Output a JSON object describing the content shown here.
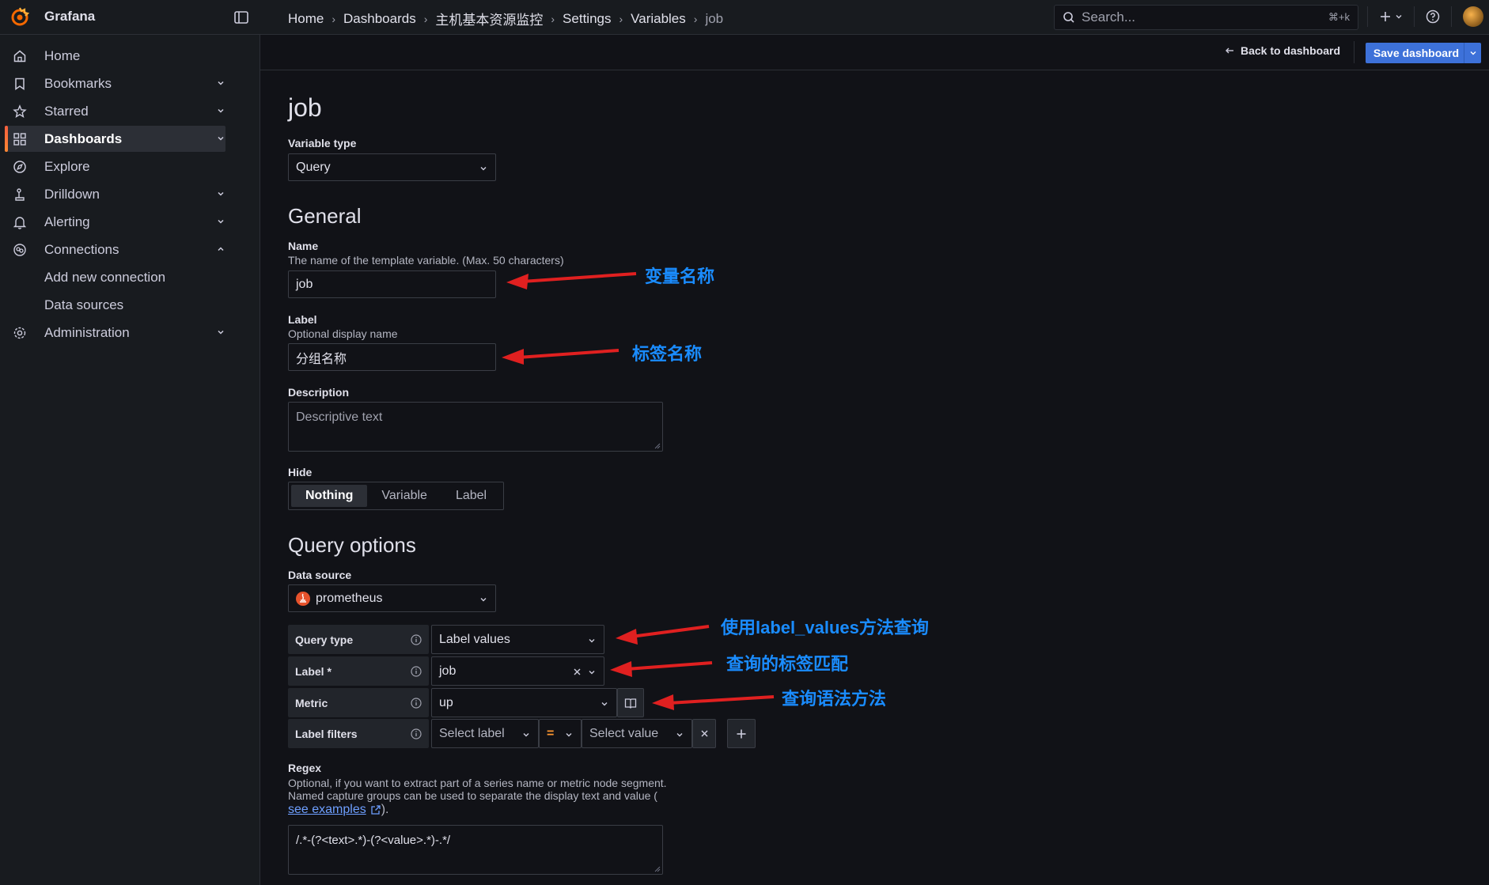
{
  "topbar": {
    "brand": "Grafana",
    "breadcrumb": [
      "Home",
      "Dashboards",
      "主机基本资源监控",
      "Settings",
      "Variables",
      "job"
    ],
    "search_placeholder": "Search...",
    "search_shortcut": "⌘+k"
  },
  "actionbar": {
    "back_label": "Back to dashboard",
    "save_label": "Save dashboard"
  },
  "sidebar": {
    "items": [
      {
        "label": "Home",
        "icon": "home-icon",
        "chevron": ""
      },
      {
        "label": "Bookmarks",
        "icon": "bookmark-icon",
        "chevron": "down"
      },
      {
        "label": "Starred",
        "icon": "star-icon",
        "chevron": "down"
      },
      {
        "label": "Dashboards",
        "icon": "apps-icon",
        "chevron": "down",
        "active": true
      },
      {
        "label": "Explore",
        "icon": "compass-icon",
        "chevron": ""
      },
      {
        "label": "Drilldown",
        "icon": "drilldown-icon",
        "chevron": "down"
      },
      {
        "label": "Alerting",
        "icon": "bell-icon",
        "chevron": "down"
      },
      {
        "label": "Connections",
        "icon": "connections-icon",
        "chevron": "up"
      },
      {
        "label": "Add new connection",
        "icon": "",
        "chevron": ""
      },
      {
        "label": "Data sources",
        "icon": "",
        "chevron": ""
      },
      {
        "label": "Administration",
        "icon": "cog-icon",
        "chevron": "down"
      }
    ]
  },
  "page": {
    "title": "job",
    "variable_type_label": "Variable type",
    "variable_type_value": "Query",
    "general_title": "General",
    "name_label": "Name",
    "name_desc": "The name of the template variable. (Max. 50 characters)",
    "name_value": "job",
    "label_label": "Label",
    "label_desc": "Optional display name",
    "label_value": "分组名称",
    "description_label": "Description",
    "description_placeholder": "Descriptive text",
    "hide_label": "Hide",
    "hide_options": [
      "Nothing",
      "Variable",
      "Label"
    ],
    "hide_selected": "Nothing",
    "query_options_title": "Query options",
    "datasource_label": "Data source",
    "datasource_value": "prometheus",
    "query_rows": {
      "query_type_label": "Query type",
      "query_type_value": "Label values",
      "label_label": "Label *",
      "label_value": "job",
      "metric_label": "Metric",
      "metric_value": "up",
      "filters_label": "Label filters",
      "filter_label_placeholder": "Select label",
      "filter_operator": "=",
      "filter_value_placeholder": "Select value"
    },
    "regex_label": "Regex",
    "regex_desc_1": "Optional, if you want to extract part of a series name or metric node segment.",
    "regex_desc_2": "Named capture groups can be used to separate the display text and value (",
    "regex_link": "see examples",
    "regex_desc_end": ").",
    "regex_value": "/.*-(?<text>.*)-(?<value>.*)-.*/"
  },
  "annotations": {
    "name": "变量名称",
    "label": "标签名称",
    "query_type": "使用label_values方法查询",
    "label_match": "查询的标签匹配",
    "metric": "查询语法方法"
  },
  "colors": {
    "accent": "#3d71d9",
    "annotation": "#1a8cff",
    "arrow": "#e02020",
    "active_bar": "#f55f3e"
  }
}
